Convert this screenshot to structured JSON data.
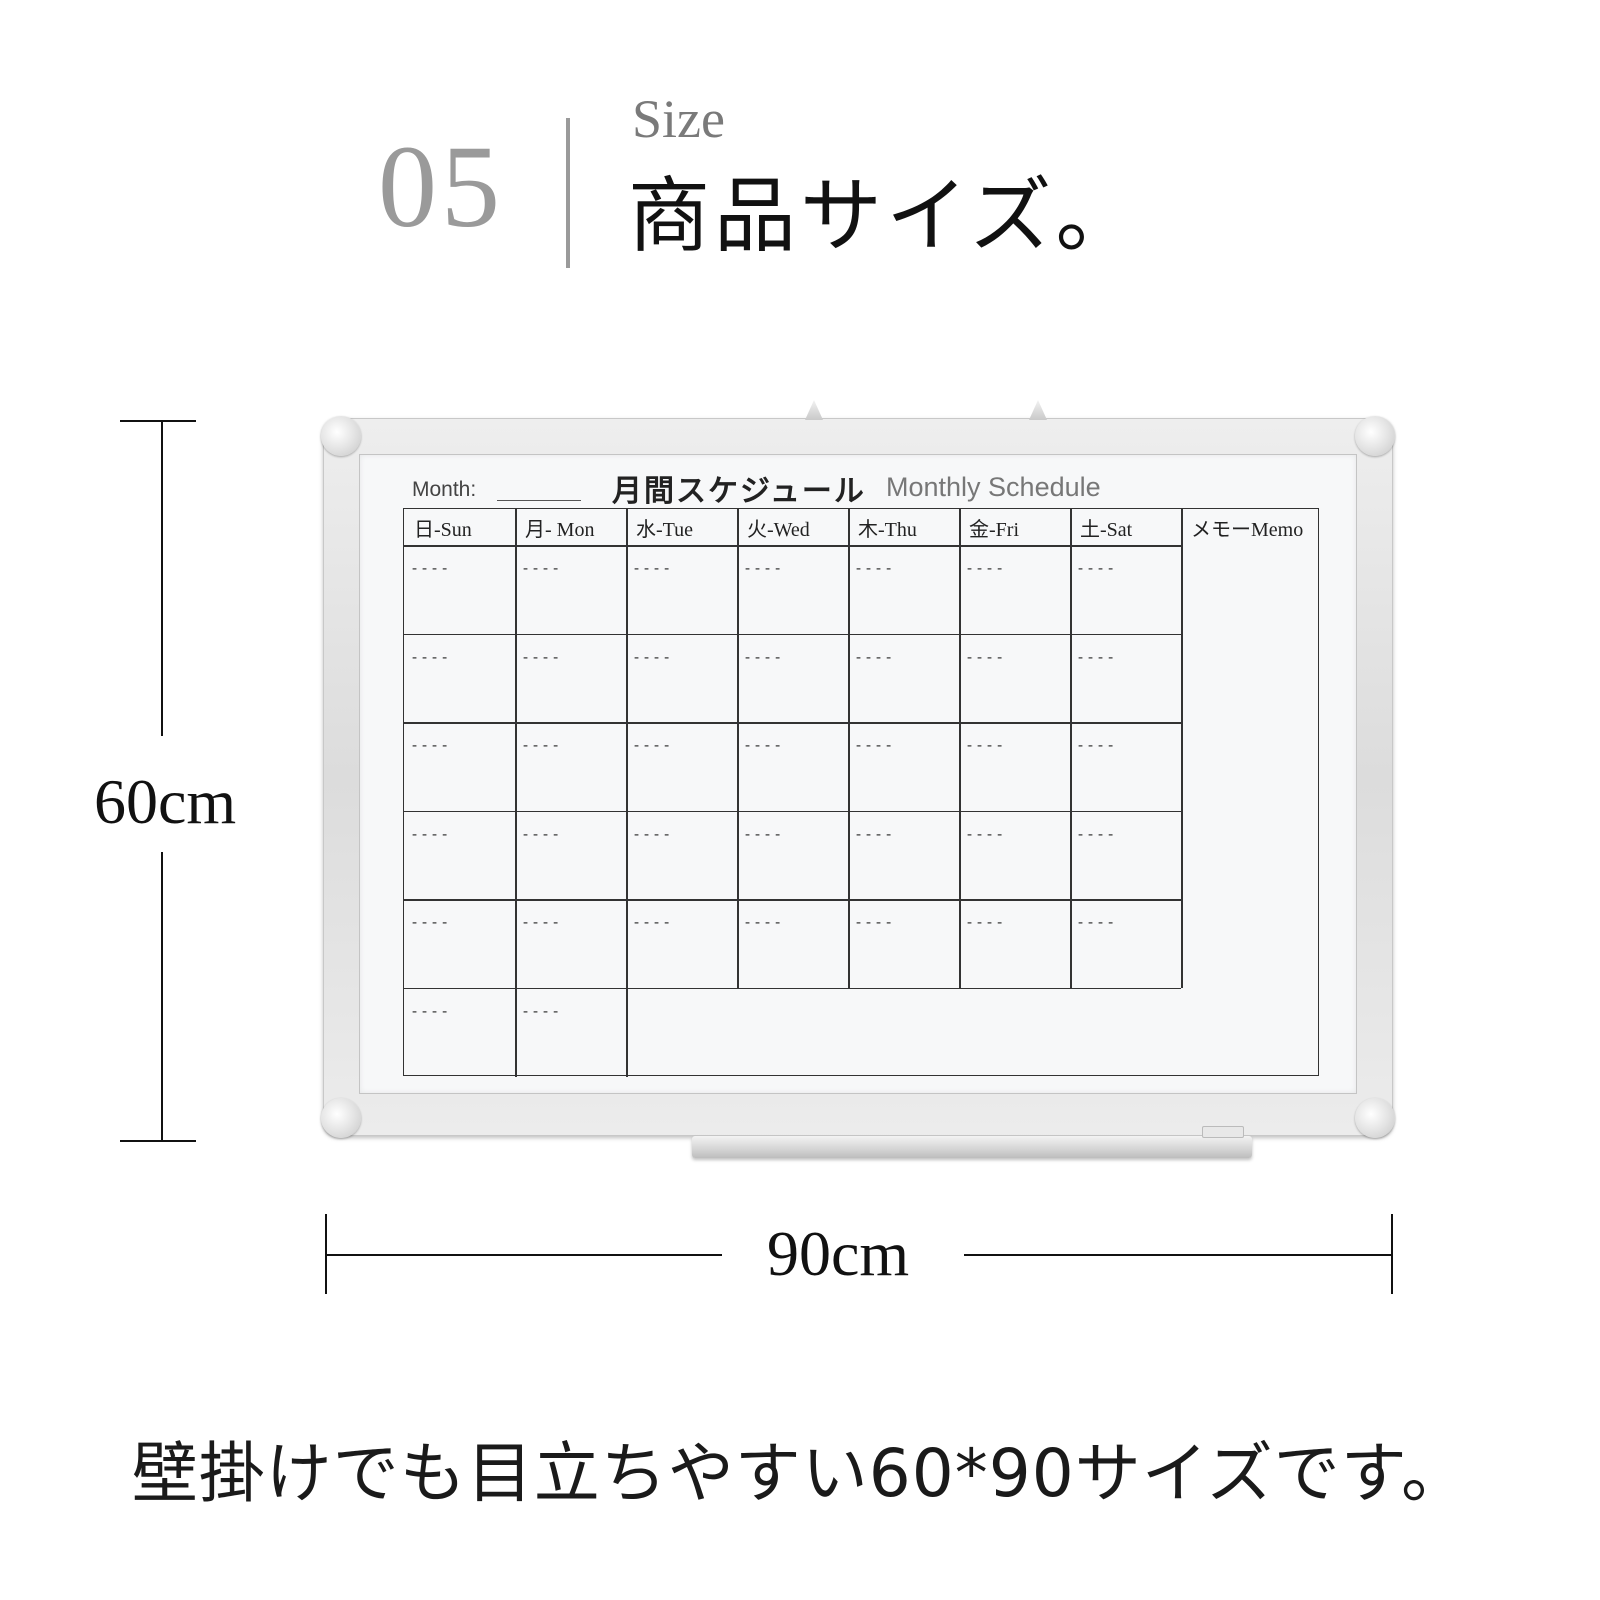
{
  "heading": {
    "number": "05",
    "subtitle": "Size",
    "title": "商品サイズ。"
  },
  "dimensions": {
    "height_label": "60cm",
    "width_label": "90cm"
  },
  "whiteboard": {
    "month_label": "Month:",
    "schedule_title_jp": "月間スケジュール",
    "schedule_title_en": "Monthly Schedule",
    "day_headers": [
      "日-Sun",
      "月- Mon",
      "水-Tue",
      "火-Wed",
      "木-Thu",
      "金-Fri",
      "土-Sat"
    ],
    "memo_header": "メモーMemo",
    "cell_placeholder": "----",
    "weeks": 6,
    "last_week_days": 2
  },
  "caption": "壁掛けでも目立ちやすい60*90サイズです。"
}
